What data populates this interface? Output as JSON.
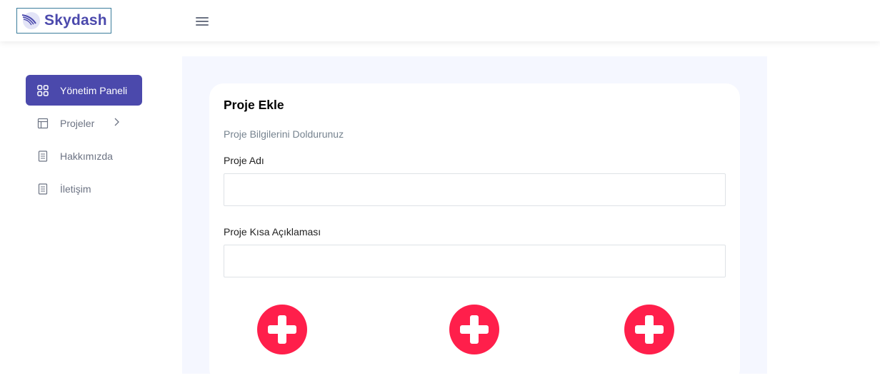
{
  "brand": {
    "name": "Skydash",
    "color": "#4b49ac"
  },
  "header": {
    "menu_icon": "hamburger-menu-icon"
  },
  "sidebar": {
    "items": [
      {
        "label": "Yönetim Paneli",
        "icon": "grid-icon",
        "active": true
      },
      {
        "label": "Projeler",
        "icon": "layout-icon",
        "has_submenu": true
      },
      {
        "label": "Hakkımızda",
        "icon": "document-icon"
      },
      {
        "label": "İletişim",
        "icon": "document-icon"
      }
    ]
  },
  "form": {
    "title": "Proje Ekle",
    "description": "Proje Bilgilerini Doldurunuz",
    "fields": [
      {
        "label": "Proje Adı",
        "value": "",
        "placeholder": ""
      },
      {
        "label": "Proje Kısa Açıklaması",
        "value": "",
        "placeholder": ""
      }
    ],
    "add_buttons": [
      {
        "icon": "plus-icon"
      },
      {
        "icon": "plus-icon"
      },
      {
        "icon": "plus-icon"
      }
    ],
    "accent_color": "#ff1f4b"
  }
}
